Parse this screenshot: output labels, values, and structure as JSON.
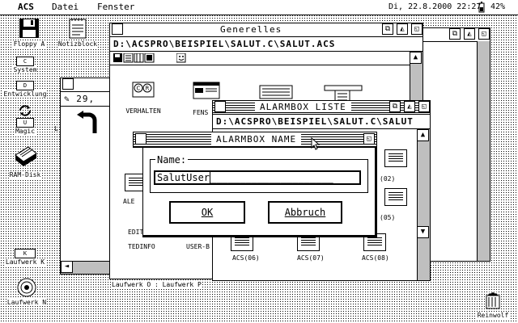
{
  "menubar": {
    "items": [
      "ACS",
      "Datei",
      "Fenster"
    ],
    "clock": "Di, 22.8.2000 22:27",
    "battery": "42%"
  },
  "desktop": {
    "icons": [
      {
        "label": "Floppy A"
      },
      {
        "label": "Notizblock"
      },
      {
        "label": "System"
      },
      {
        "label": "Entwicklung"
      },
      {
        "label": "Magic"
      },
      {
        "label": "RAM-Disk"
      },
      {
        "label": "Laufwerk K"
      },
      {
        "label": "Laufwerk N"
      },
      {
        "label": "Reinwolf"
      }
    ]
  },
  "win_back": {
    "info_text": "29,",
    "partial_L": "L"
  },
  "win_generelles": {
    "title": "Generelles",
    "path": "D:\\ACSPRO\\BEISPIEL\\SALUT.C\\SALUT.ACS",
    "items": [
      "VERHALTEN",
      "FENS",
      "EDIT",
      "TEDINFO",
      "USER-B",
      "ALE"
    ],
    "drives_text": "Laufwerk O : Laufwerk P"
  },
  "win_alarmbox": {
    "title": "ALARMBOX LISTE",
    "path": "D:\\ACSPRO\\BEISPIEL\\SALUT.C\\SALUT",
    "items": [
      "(02)",
      "(05)",
      "ACS(06)",
      "ACS(07)",
      "ACS(08)"
    ]
  },
  "dialog": {
    "title": "ALARMBOX NAME",
    "field_label": "Name:",
    "field_value": "SalutUser",
    "field_placeholder": "_____________________",
    "ok_label": "OK",
    "cancel_label": "Abbruch"
  },
  "icons": {
    "close": "close-box-icon",
    "full": "full-box-icon",
    "iconify": "iconify-box-icon",
    "up": "▲",
    "down": "▼",
    "left": "◄",
    "right": "►"
  }
}
